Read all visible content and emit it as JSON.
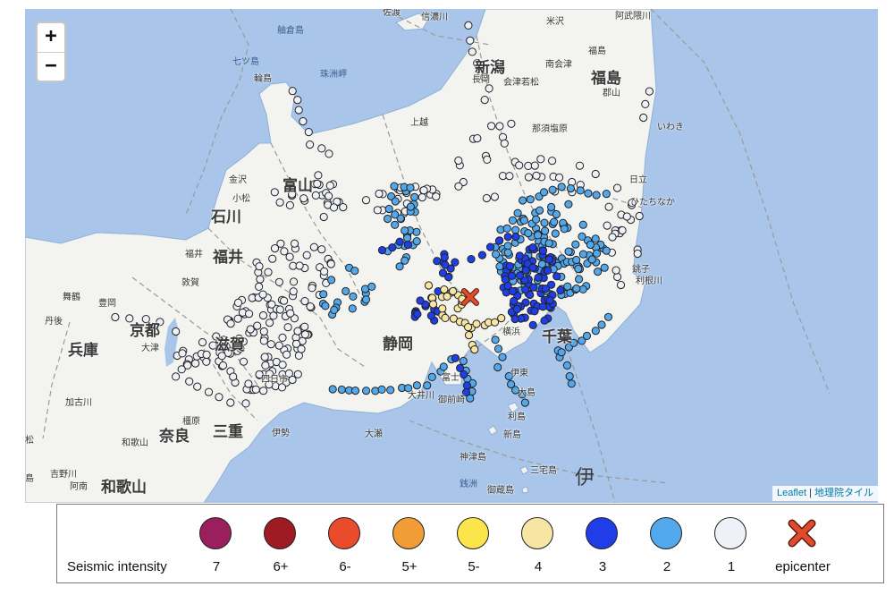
{
  "map": {
    "zoom_in_label": "+",
    "zoom_out_label": "−",
    "attribution": {
      "leaflet": "Leaflet",
      "separator": " | ",
      "tiles": "地理院タイル"
    },
    "place_names": [
      {
        "text": "佐渡",
        "cls": "minor"
      },
      {
        "text": "信濃川",
        "cls": "minor"
      },
      {
        "text": "米沢",
        "cls": "minor"
      },
      {
        "text": "福島",
        "cls": "minor"
      },
      {
        "text": "阿武隈川",
        "cls": "minor"
      },
      {
        "text": "舳倉島",
        "cls": "sea"
      },
      {
        "text": "七ツ島",
        "cls": "sea"
      },
      {
        "text": "輪島",
        "cls": "minor"
      },
      {
        "text": "珠洲岬",
        "cls": "sea"
      },
      {
        "text": "新潟",
        "cls": "major"
      },
      {
        "text": "長岡",
        "cls": "minor"
      },
      {
        "text": "会津若松",
        "cls": "minor"
      },
      {
        "text": "南会津",
        "cls": "minor"
      },
      {
        "text": "福島",
        "cls": "major"
      },
      {
        "text": "郡山",
        "cls": "minor"
      },
      {
        "text": "いわき",
        "cls": "minor"
      },
      {
        "text": "那須塩原",
        "cls": "minor"
      },
      {
        "text": "上越",
        "cls": "minor"
      },
      {
        "text": "金沢",
        "cls": "minor"
      },
      {
        "text": "富山",
        "cls": "major"
      },
      {
        "text": "小松",
        "cls": "minor"
      },
      {
        "text": "石川",
        "cls": "major"
      },
      {
        "text": "日立",
        "cls": "minor"
      },
      {
        "text": "ひたちなか",
        "cls": "minor"
      },
      {
        "text": "福井",
        "cls": "major"
      },
      {
        "text": "福井",
        "cls": "minor"
      },
      {
        "text": "敦賀",
        "cls": "minor"
      },
      {
        "text": "銚子",
        "cls": "minor"
      },
      {
        "text": "舞鶴",
        "cls": "minor"
      },
      {
        "text": "丹後",
        "cls": "minor"
      },
      {
        "text": "豊岡",
        "cls": "minor"
      },
      {
        "text": "京都",
        "cls": "major"
      },
      {
        "text": "滋賀",
        "cls": "major"
      },
      {
        "text": "兵庫",
        "cls": "major"
      },
      {
        "text": "大津",
        "cls": "minor"
      },
      {
        "text": "四日市",
        "cls": "minor"
      },
      {
        "text": "加古川",
        "cls": "minor"
      },
      {
        "text": "奈良",
        "cls": "major"
      },
      {
        "text": "三重",
        "cls": "major"
      },
      {
        "text": "伊勢",
        "cls": "minor"
      },
      {
        "text": "橿原",
        "cls": "minor"
      },
      {
        "text": "和歌山",
        "cls": "minor"
      },
      {
        "text": "和歌山",
        "cls": "major"
      },
      {
        "text": "吉野川",
        "cls": "minor"
      },
      {
        "text": "阿南",
        "cls": "minor"
      },
      {
        "text": "静岡",
        "cls": "major"
      },
      {
        "text": "大井川",
        "cls": "minor"
      },
      {
        "text": "御前崎",
        "cls": "minor"
      },
      {
        "text": "富士",
        "cls": "minor"
      },
      {
        "text": "伊東",
        "cls": "minor"
      },
      {
        "text": "横浜",
        "cls": "minor"
      },
      {
        "text": "千葉",
        "cls": "major"
      },
      {
        "text": "大島",
        "cls": "minor"
      },
      {
        "text": "利島",
        "cls": "minor"
      },
      {
        "text": "新島",
        "cls": "minor"
      },
      {
        "text": "神津島",
        "cls": "minor"
      },
      {
        "text": "三宅島",
        "cls": "minor"
      },
      {
        "text": "銭洲",
        "cls": "sea"
      },
      {
        "text": "御蔵島",
        "cls": "minor"
      },
      {
        "text": "伊",
        "cls": "big"
      },
      {
        "text": "大瀬",
        "cls": "minor"
      },
      {
        "text": "松",
        "cls": "minor"
      },
      {
        "text": "島",
        "cls": "minor"
      },
      {
        "text": "利根川",
        "cls": "minor"
      },
      {
        "text": "越",
        "cls": "minor"
      }
    ],
    "epicenter_label": "epicenter"
  },
  "legend": {
    "title": "Seismic intensity",
    "items": [
      {
        "label": "7",
        "color": "#9b1f5d",
        "kind": "circle",
        "name": "intensity-7-swatch"
      },
      {
        "label": "6+",
        "color": "#9e1b24",
        "kind": "circle",
        "name": "intensity-6plus-swatch"
      },
      {
        "label": "6-",
        "color": "#ea4b2a",
        "kind": "circle",
        "name": "intensity-6minus-swatch"
      },
      {
        "label": "5+",
        "color": "#f29c38",
        "kind": "circle",
        "name": "intensity-5plus-swatch"
      },
      {
        "label": "5-",
        "color": "#fbe54a",
        "kind": "circle",
        "name": "intensity-5minus-swatch"
      },
      {
        "label": "4",
        "color": "#f7e6a3",
        "kind": "circle",
        "name": "intensity-4-swatch"
      },
      {
        "label": "3",
        "color": "#1f3ee8",
        "kind": "circle",
        "name": "intensity-3-swatch"
      },
      {
        "label": "2",
        "color": "#53a8ec",
        "kind": "circle",
        "name": "intensity-2-swatch"
      },
      {
        "label": "1",
        "color": "#eef1f8",
        "kind": "circle",
        "name": "intensity-1-swatch"
      },
      {
        "label": "epicenter",
        "color": "#e04b2a",
        "kind": "x",
        "name": "epicenter-swatch"
      }
    ]
  },
  "colors": {
    "sea": "#a9c6ea",
    "land": "#f3f3ef",
    "border": "#9a9a9a",
    "intensity_4": "#f7e6a3",
    "intensity_3": "#1f3ee8",
    "intensity_2": "#53a8ec",
    "intensity_1": "#eef1f8",
    "epicenter": "#e04b2a"
  }
}
